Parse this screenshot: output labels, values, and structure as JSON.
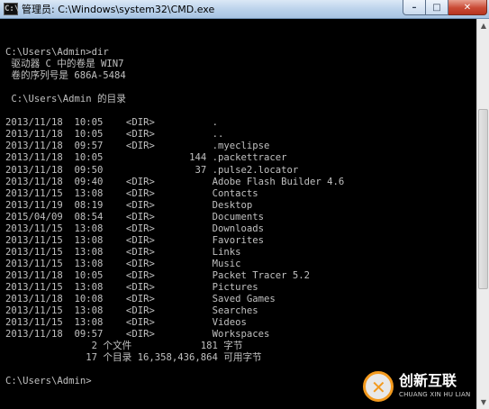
{
  "window": {
    "title": "管理员: C:\\Windows\\system32\\CMD.exe",
    "icon": "cmd-icon",
    "minimize_label": "–",
    "maximize_label": "□",
    "close_label": "✕"
  },
  "console": {
    "lines": [
      "C:\\Users\\Admin>dir",
      " 驱动器 C 中的卷是 WIN7",
      " 卷的序列号是 686A-5484",
      "",
      " C:\\Users\\Admin 的目录",
      "",
      "2013/11/18  10:05    <DIR>          .",
      "2013/11/18  10:05    <DIR>          ..",
      "2013/11/18  09:57    <DIR>          .myeclipse",
      "2013/11/18  10:05               144 .packettracer",
      "2013/11/18  09:50                37 .pulse2.locator",
      "2013/11/18  09:40    <DIR>          Adobe Flash Builder 4.6",
      "2013/11/15  13:08    <DIR>          Contacts",
      "2013/11/19  08:19    <DIR>          Desktop",
      "2015/04/09  08:54    <DIR>          Documents",
      "2013/11/15  13:08    <DIR>          Downloads",
      "2013/11/15  13:08    <DIR>          Favorites",
      "2013/11/15  13:08    <DIR>          Links",
      "2013/11/15  13:08    <DIR>          Music",
      "2013/11/18  10:05    <DIR>          Packet Tracer 5.2",
      "2013/11/15  13:08    <DIR>          Pictures",
      "2013/11/18  10:08    <DIR>          Saved Games",
      "2013/11/15  13:08    <DIR>          Searches",
      "2013/11/15  13:08    <DIR>          Videos",
      "2013/11/18  09:57    <DIR>          Workspaces",
      "               2 个文件            181 字节",
      "              17 个目录 16,358,436,864 可用字节",
      "",
      "C:\\Users\\Admin>"
    ]
  },
  "watermark": {
    "name": "创新互联",
    "sub": "CHUANG XIN HU LIAN"
  },
  "colors": {
    "console_bg": "#000000",
    "console_fg": "#c0c0c0",
    "accent": "#f39a1e"
  }
}
